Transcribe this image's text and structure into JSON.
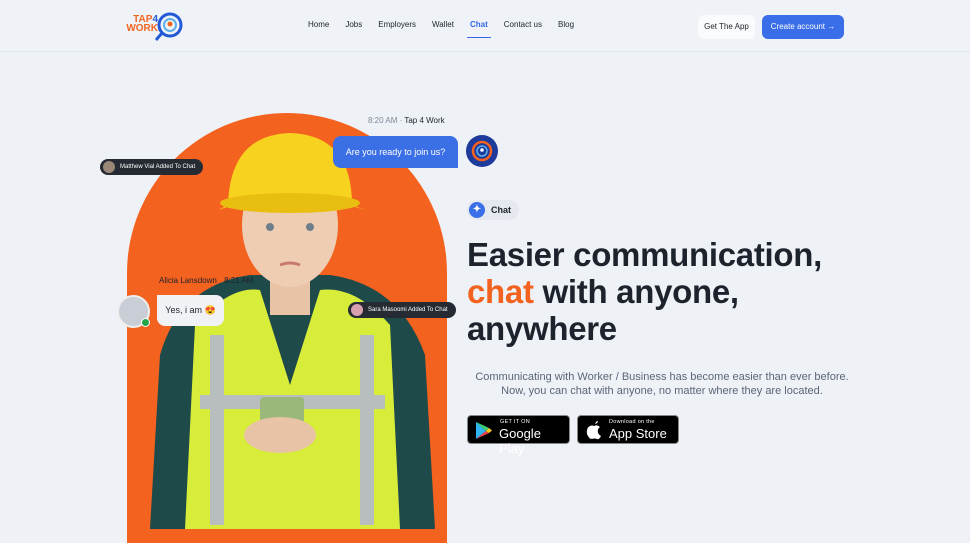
{
  "header": {
    "logo": {
      "line1": "TAP",
      "digit": "4",
      "line2": "WORK"
    },
    "nav": [
      {
        "label": "Home"
      },
      {
        "label": "Jobs"
      },
      {
        "label": "Employers"
      },
      {
        "label": "Wallet"
      },
      {
        "label": "Chat",
        "active": true
      },
      {
        "label": "Contact us"
      },
      {
        "label": "Blog"
      }
    ],
    "get_app": "Get The App",
    "create_account": "Create account",
    "create_icon": "arrow-right-icon"
  },
  "chat_demo": {
    "time1": "8:20 AM",
    "sender1": "Tap 4 Work",
    "message1": "Are you ready to join us?",
    "notice1": "Matthew Vial Added To Chat",
    "sender2": "Alicia Lansdown",
    "time2": "8:21 AM",
    "message2": "Yes, i am 😍",
    "notice2": "Sara Masoomi Added To Chat"
  },
  "hero": {
    "tag": "Chat",
    "tag_icon": "sparkle-icon",
    "title_line1": "Easier communication,",
    "title_accent": "chat",
    "title_line2_rest": " with anyone,",
    "title_line3": "anywhere",
    "description": "Communicating with Worker / Business has become easier than ever before. Now, you can chat with anyone, no matter where they are located.",
    "google_small": "GET IT ON",
    "google_large": "Google Play",
    "apple_small": "Download on the",
    "apple_large": "App Store"
  },
  "colors": {
    "accent": "#3a6ee8",
    "orange": "#f4621f",
    "background": "#eef2f6"
  }
}
